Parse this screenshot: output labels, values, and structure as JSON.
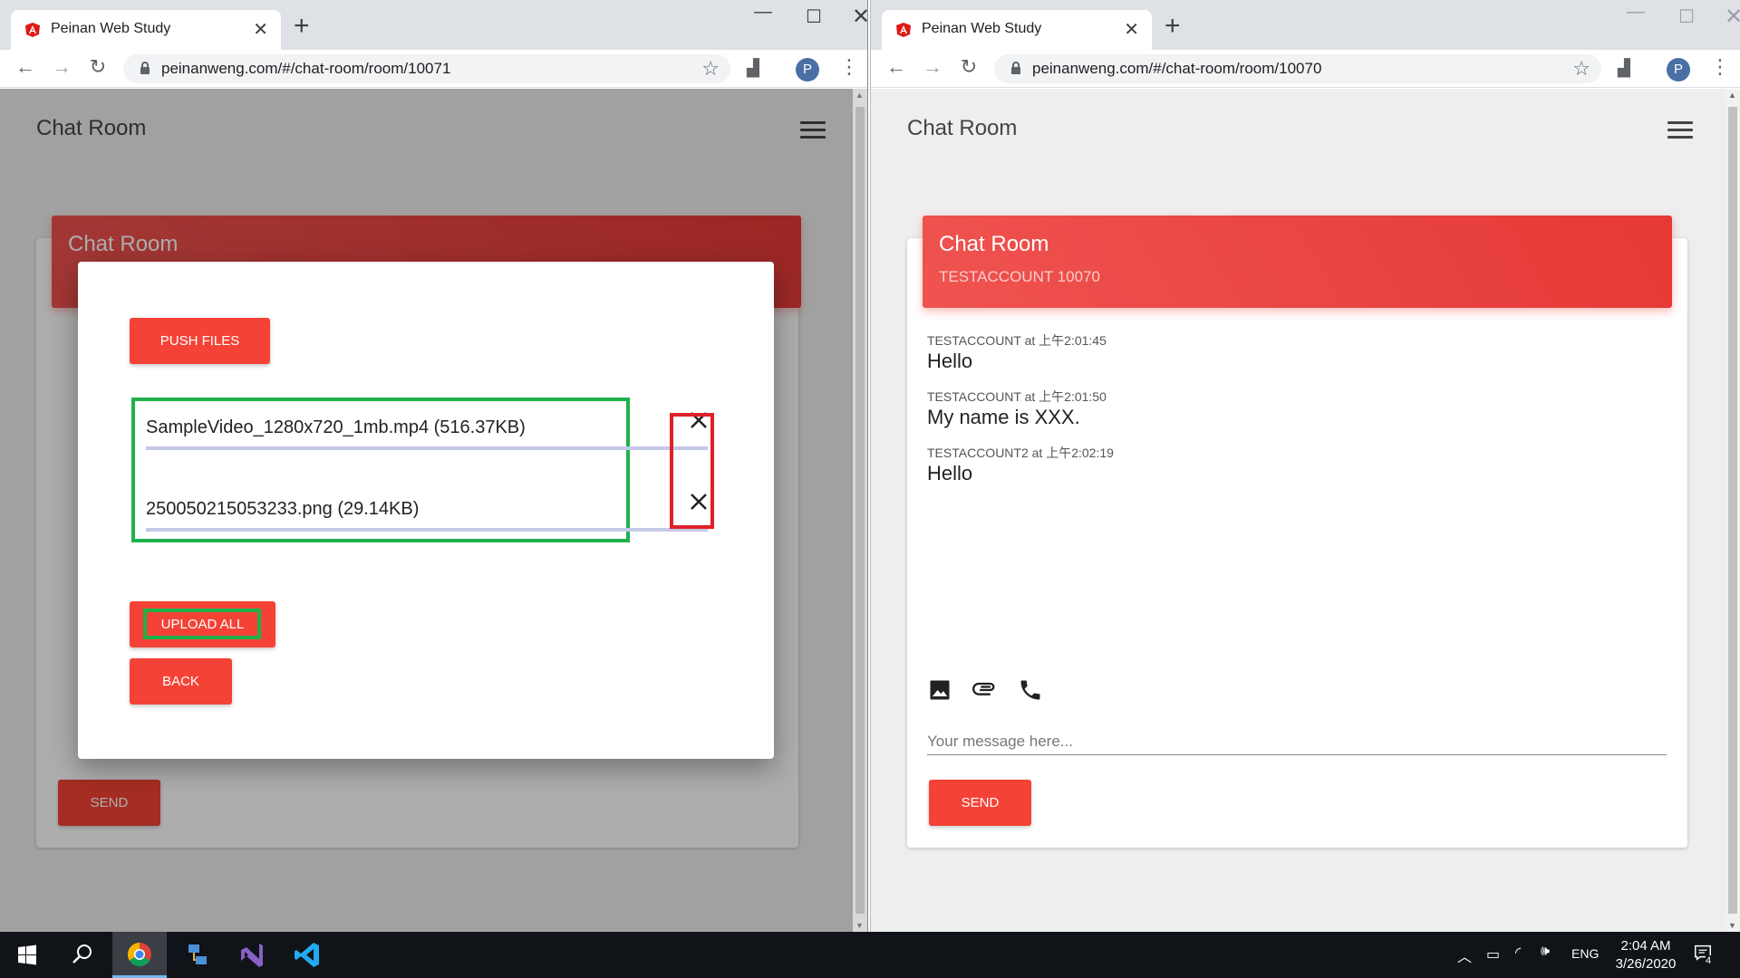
{
  "left_window": {
    "tab_title": "Peinan Web Study",
    "url": "peinanweng.com/#/chat-room/room/10071",
    "app_title": "Chat Room",
    "card_title": "Chat Room",
    "send_label": "SEND",
    "dialog": {
      "push_label": "PUSH FILES",
      "files": [
        {
          "name": "SampleVideo_1280x720_1mb.mp4 (516.37KB)"
        },
        {
          "name": "250050215053233.png (29.14KB)"
        }
      ],
      "upload_label": "UPLOAD ALL",
      "back_label": "BACK"
    }
  },
  "right_window": {
    "tab_title": "Peinan Web Study",
    "url": "peinanweng.com/#/chat-room/room/10070",
    "app_title": "Chat Room",
    "card_title": "Chat Room",
    "card_subtitle": "TESTACCOUNT 10070",
    "messages": [
      {
        "meta": "TESTACCOUNT at 上午2:01:45",
        "text": "Hello"
      },
      {
        "meta": "TESTACCOUNT at 上午2:01:50",
        "text": "My name is XXX."
      },
      {
        "meta": "TESTACCOUNT2 at 上午2:02:19",
        "text": "Hello"
      }
    ],
    "input_placeholder": "Your message here...",
    "send_label": "SEND"
  },
  "profile_initial": "P",
  "taskbar": {
    "language": "ENG",
    "time": "2:04 AM",
    "date": "3/26/2020",
    "notification_count": "4"
  },
  "colors": {
    "accent": "#f44336",
    "highlight_green": "#1fb14c",
    "highlight_red": "#e0202a"
  }
}
